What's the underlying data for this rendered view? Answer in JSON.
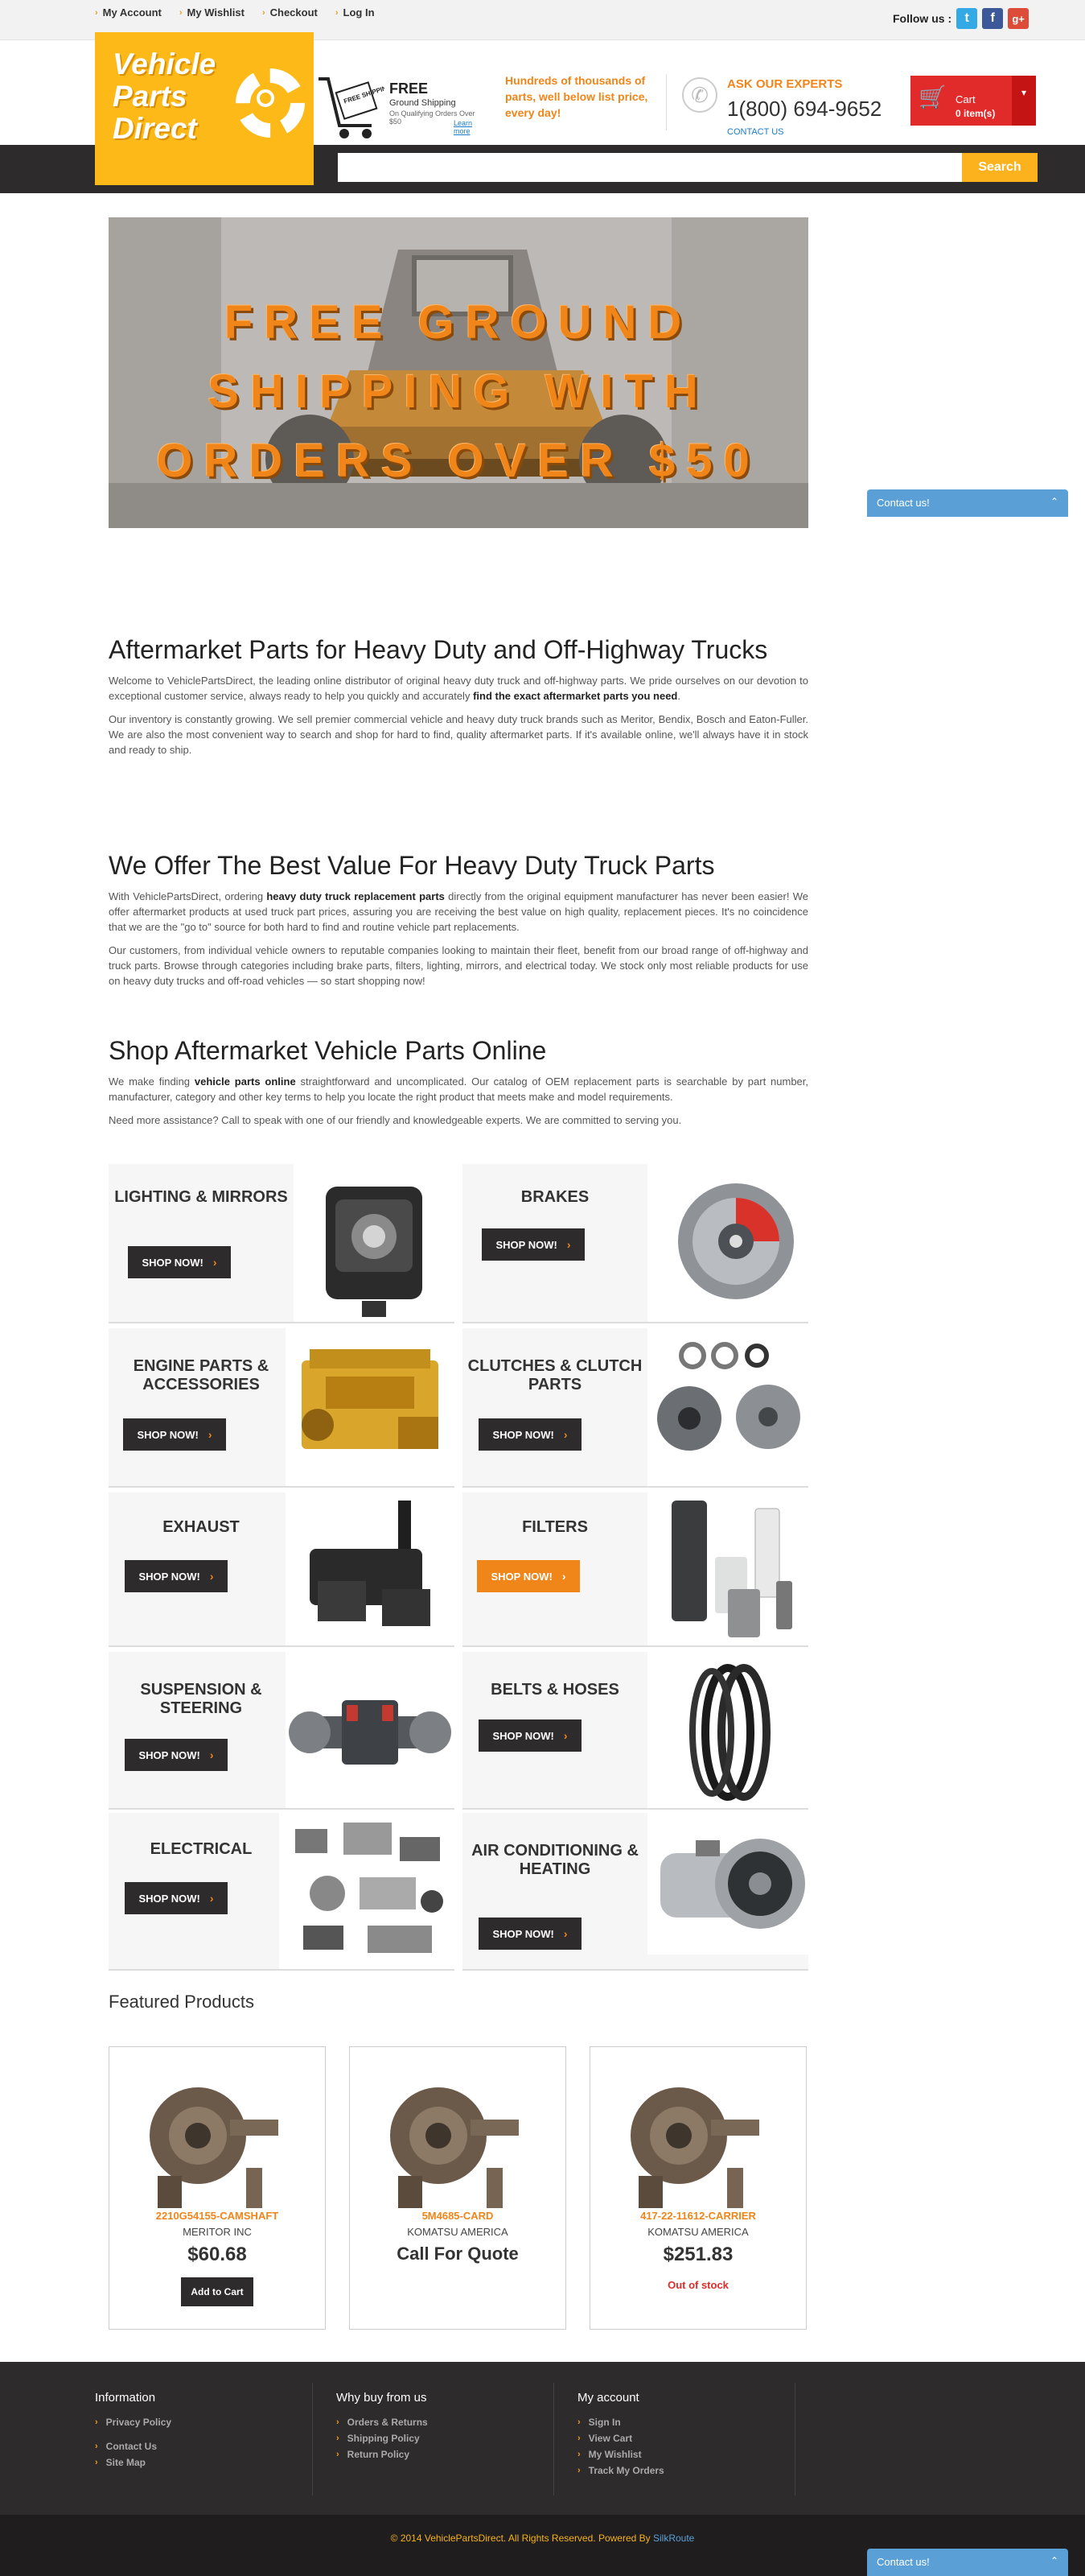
{
  "topbar": {
    "links": [
      "My Account",
      "My Wishlist",
      "Checkout",
      "Log In"
    ],
    "follow_label": "Follow us :",
    "social": [
      {
        "name": "twitter-icon",
        "glyph": "t",
        "color": "#33a9e6"
      },
      {
        "name": "facebook-icon",
        "glyph": "f",
        "color": "#3b5998"
      },
      {
        "name": "google-plus-icon",
        "glyph": "g+",
        "color": "#dd4b39"
      }
    ]
  },
  "header": {
    "logo": "Vehicle Parts Direct",
    "free_shipping": {
      "title": "FREE",
      "subtitle": "Ground Shipping",
      "note": "On Qualifying Orders Over $50",
      "learn_more": "Learn more",
      "sign": "FREE SHIPPING"
    },
    "promo": "Hundreds of thousands of parts, well below list price, every day!",
    "ask": "ASK OUR EXPERTS",
    "phone": "1(800) 694-9652",
    "contact_us": "CONTACT US",
    "cart_label": "Cart",
    "cart_count": "0 item(s)"
  },
  "search": {
    "placeholder": "",
    "button": "Search"
  },
  "banner": {
    "text": "FREE GROUND SHIPPING WITH ORDERS OVER $50"
  },
  "contact_widget": "Contact us!",
  "sections": {
    "s1_title": "Aftermarket Parts for Heavy Duty and Off-Highway Trucks",
    "s1_p1a": "Welcome to VehiclePartsDirect, the leading online distributor of original heavy duty truck and off-highway parts. We pride ourselves on our devotion to exceptional customer service, always ready to help you quickly and accurately ",
    "s1_p1b": "find the exact aftermarket parts you need",
    "s1_p1c": ".",
    "s1_p2": "Our inventory is constantly growing. We sell premier commercial vehicle and heavy duty truck brands such as Meritor, Bendix, Bosch and Eaton-Fuller. We are also the most convenient way to search and shop for hard to find, quality aftermarket parts. If it's available online, we'll always have it in stock and ready to ship.",
    "s2_title": "We Offer The Best Value For Heavy Duty Truck Parts",
    "s2_p1a": "With VehiclePartsDirect, ordering ",
    "s2_p1b": "heavy duty truck replacement parts",
    "s2_p1c": " directly from the original equipment manufacturer has never been easier! We offer aftermarket products at used truck part prices, assuring you are receiving the best value on high quality, replacement pieces. It's no coincidence that we are the \"go to\" source for both hard to find and routine vehicle part replacements.",
    "s2_p2": "Our customers, from individual vehicle owners to reputable companies looking to maintain their fleet, benefit from our broad range of off-highway and truck parts. Browse through categories including brake parts, filters, lighting, mirrors, and electrical today. We stock only most reliable products for use on heavy duty trucks and off-road vehicles — so start shopping now!",
    "s3_title": "Shop Aftermarket Vehicle Parts Online",
    "s3_p1a": "We make finding ",
    "s3_p1b": "vehicle parts online",
    "s3_p1c": " straightforward and uncomplicated. Our catalog of OEM replacement parts is searchable by part number, manufacturer, category and other key terms to help you locate the right product that meets make and model requirements.",
    "s3_p2": "Need more assistance? Call to speak with one of our friendly and knowledgeable experts. We are committed to serving you."
  },
  "categories": [
    {
      "title": "LIGHTING & MIRRORS",
      "button": "SHOP NOW!",
      "highlight": false
    },
    {
      "title": "BRAKES",
      "button": "SHOP NOW!",
      "highlight": false
    },
    {
      "title": "ENGINE PARTS & ACCESSORIES",
      "button": "SHOP NOW!",
      "highlight": false
    },
    {
      "title": "CLUTCHES & CLUTCH PARTS",
      "button": "SHOP NOW!",
      "highlight": false
    },
    {
      "title": "EXHAUST",
      "button": "SHOP NOW!",
      "highlight": false
    },
    {
      "title": "FILTERS",
      "button": "SHOP NOW!",
      "highlight": true
    },
    {
      "title": "SUSPENSION & STEERING",
      "button": "SHOP NOW!",
      "highlight": false
    },
    {
      "title": "BELTS & HOSES",
      "button": "SHOP NOW!",
      "highlight": false
    },
    {
      "title": "ELECTRICAL",
      "button": "SHOP NOW!",
      "highlight": false
    },
    {
      "title": "AIR CONDITIONING & HEATING",
      "button": "SHOP NOW!",
      "highlight": false
    }
  ],
  "featured": {
    "title": "Featured Products",
    "products": [
      {
        "sku": "2210G54155-CAMSHAFT",
        "brand": "MERITOR INC",
        "price": "$60.68",
        "action": "Add to Cart"
      },
      {
        "sku": "5M4685-CARD",
        "brand": "KOMATSU AMERICA",
        "price": "Call For Quote"
      },
      {
        "sku": "417-22-11612-CARRIER",
        "brand": "KOMATSU AMERICA",
        "price": "$251.83",
        "status": "Out of stock"
      }
    ]
  },
  "footer": {
    "info_title": "Information",
    "info_links": [
      "Privacy Policy",
      "Contact Us",
      "Site Map"
    ],
    "why_title": "Why buy from us",
    "why_links": [
      "Orders & Returns",
      "Shipping Policy",
      "Return Policy"
    ],
    "account_title": "My account",
    "account_links": [
      "Sign In",
      "View Cart",
      "My Wishlist",
      "Track My Orders"
    ],
    "copyright": "© 2014 VehiclePartsDirect. All Rights Reserved. Powered By ",
    "powered_by": "SilkRoute"
  }
}
